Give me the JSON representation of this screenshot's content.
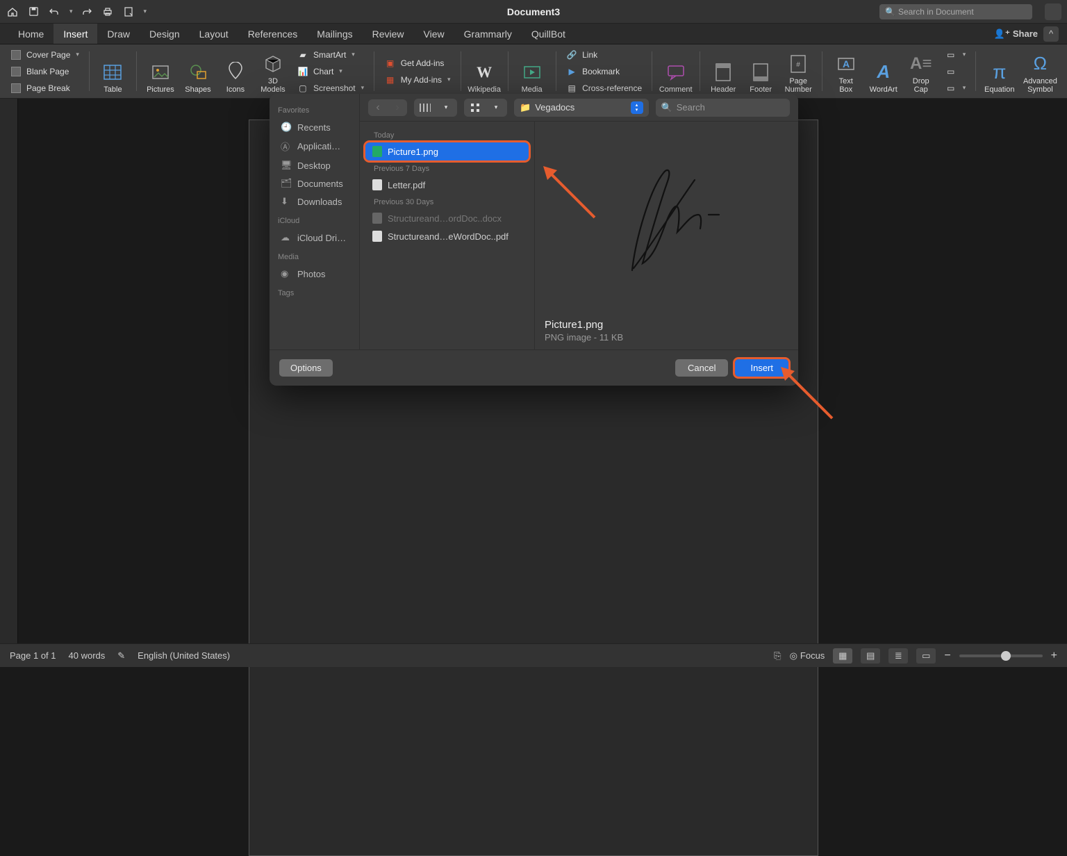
{
  "titlebar": {
    "doc_title": "Document3",
    "search_placeholder": "Search in Document"
  },
  "tabs": {
    "items": [
      "Home",
      "Insert",
      "Draw",
      "Design",
      "Layout",
      "References",
      "Mailings",
      "Review",
      "View",
      "Grammarly",
      "QuillBot"
    ],
    "active_index": 1,
    "share_label": "Share"
  },
  "ribbon": {
    "pages": {
      "cover": "Cover Page",
      "blank": "Blank Page",
      "break": "Page Break"
    },
    "table": "Table",
    "pictures": "Pictures",
    "shapes": "Shapes",
    "icons": "Icons",
    "models": "3D Models",
    "illus": {
      "smartart": "SmartArt",
      "chart": "Chart",
      "screenshot": "Screenshot"
    },
    "addins": {
      "get": "Get Add-ins",
      "my": "My Add-ins"
    },
    "wikipedia": "Wikipedia",
    "media": "Media",
    "links": {
      "link": "Link",
      "bookmark": "Bookmark",
      "xref": "Cross-reference"
    },
    "comment": "Comment",
    "header": "Header",
    "footer": "Footer",
    "pagenum": "Page Number",
    "textbox": "Text Box",
    "wordart": "WordArt",
    "dropcap": "Drop Cap",
    "equation": "Equation",
    "symbol": "Advanced Symbol"
  },
  "dialog": {
    "sidebar": {
      "favorites_head": "Favorites",
      "favorites": [
        "Recents",
        "Applicati…",
        "Desktop",
        "Documents",
        "Downloads"
      ],
      "icloud_head": "iCloud",
      "icloud": [
        "iCloud Dri…"
      ],
      "media_head": "Media",
      "media": [
        "Photos"
      ],
      "tags_head": "Tags"
    },
    "location": "Vegadocs",
    "search_placeholder": "Search",
    "filelist": {
      "today_head": "Today",
      "today": [
        "Picture1.png"
      ],
      "prev7_head": "Previous 7 Days",
      "prev7": [
        "Letter.pdf"
      ],
      "prev30_head": "Previous 30 Days",
      "prev30": [
        "Structureand…ordDoc..docx",
        "Structureand…eWordDoc..pdf"
      ]
    },
    "preview": {
      "name": "Picture1.png",
      "meta": "PNG image - 11 KB"
    },
    "buttons": {
      "options": "Options",
      "cancel": "Cancel",
      "insert": "Insert"
    }
  },
  "statusbar": {
    "page": "Page 1 of 1",
    "words": "40 words",
    "lang": "English (United States)",
    "focus": "Focus"
  }
}
